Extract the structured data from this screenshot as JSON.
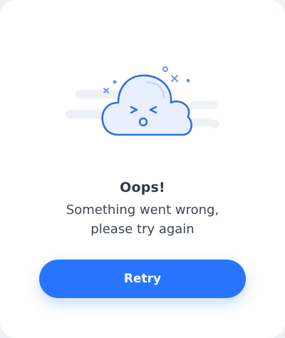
{
  "error_card": {
    "title": "Oops!",
    "message": "Something went wrong,\nplease try again",
    "retry_label": "Retry"
  },
  "colors": {
    "accent": "#2775ff",
    "illustration_stroke": "#2f6fe0",
    "cloud_fill": "#e9f0fd",
    "streak": "#eef1f6"
  },
  "icons": {
    "illustration": "sad-cloud-icon"
  }
}
